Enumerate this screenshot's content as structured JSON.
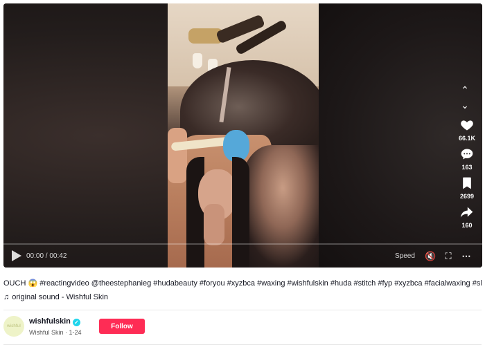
{
  "player": {
    "time": "00:00 / 00:42",
    "speed_label": "Speed",
    "progress": 0.0
  },
  "actions": [
    {
      "icon": "heart-icon",
      "count": "66.1K"
    },
    {
      "icon": "comment-icon",
      "count": "163"
    },
    {
      "icon": "bookmark-icon",
      "count": "2699"
    },
    {
      "icon": "share-icon",
      "count": "160"
    }
  ],
  "caption": {
    "text": "OUCH 😱 #reactingvideo @theestephanieg #hudabeauty #foryou #xyzbca #waxing #wishfulskin #huda #stitch #fyp #xyzbca #facialwaxing #skincare"
  },
  "sound": {
    "label": "original sound - Wishful Skin"
  },
  "author": {
    "avatar_text": "wishful",
    "username": "wishfulskin",
    "subline": "Wishful Skin · 1-24",
    "follow_label": "Follow"
  },
  "colors": {
    "follow": "#fe2c55",
    "verified": "#20d5ec"
  }
}
